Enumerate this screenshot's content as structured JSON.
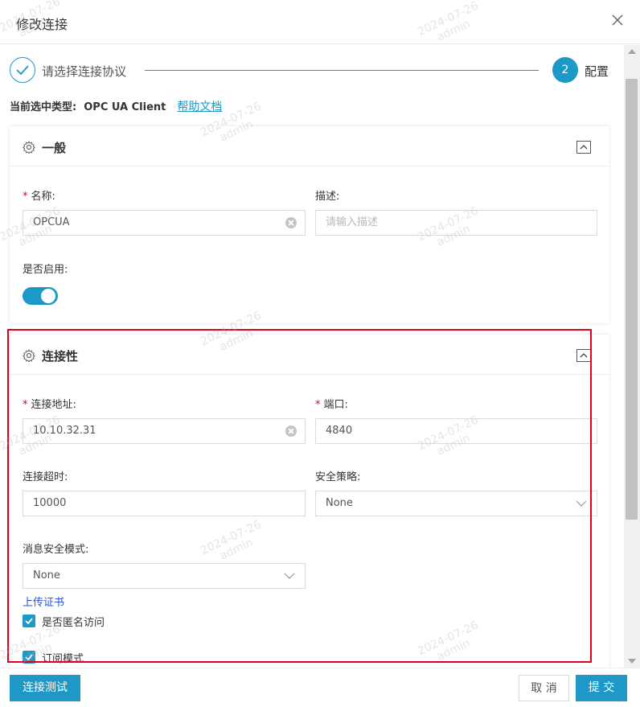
{
  "dialog": {
    "title": "修改连接"
  },
  "steps": {
    "step1_label": "请选择连接协议",
    "step2_number": "2",
    "step2_label": "配置"
  },
  "type_row": {
    "label": "当前选中类型:  OPC UA Client",
    "help_link": "帮助文档"
  },
  "general": {
    "title": "一般",
    "name_label": "名称:",
    "name_value": "OPCUA",
    "desc_label": "描述:",
    "desc_placeholder": "请输入描述",
    "enabled_label": "是否启用:",
    "enabled": true
  },
  "connectivity": {
    "title": "连接性",
    "address_label": "连接地址:",
    "address_value": "10.10.32.31",
    "port_label": "端口:",
    "port_value": "4840",
    "timeout_label": "连接超时:",
    "timeout_value": "10000",
    "security_policy_label": "安全策略:",
    "security_policy_value": "None",
    "message_mode_label": "消息安全模式:",
    "message_mode_value": "None",
    "upload_cert": "上传证书",
    "anonymous_label": "是否匿名访问",
    "anonymous_checked": true,
    "subscribe_label": "订阅模式",
    "subscribe_checked": true
  },
  "footer": {
    "test_button": "连接测试",
    "cancel_button": "取 消",
    "submit_button": "提 交"
  },
  "watermark": {
    "date": "2024-07-26",
    "user": "admin"
  },
  "colors": {
    "accent": "#1d98c7",
    "required": "#e0001a",
    "highlight_box": "#e0001a",
    "link": "#2b56c8"
  }
}
